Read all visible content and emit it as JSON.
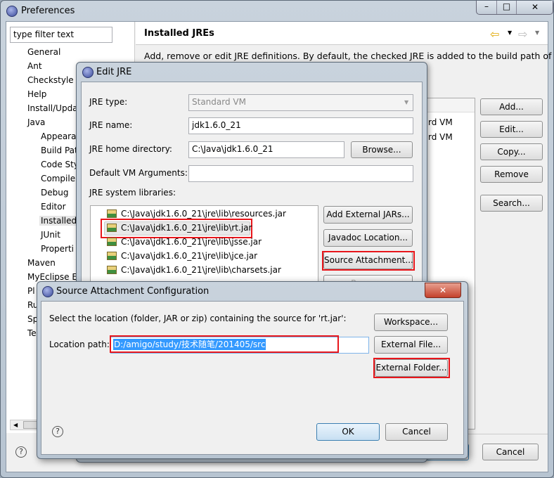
{
  "preferences": {
    "title": "Preferences",
    "filter_placeholder": "type filter text",
    "tree": [
      {
        "label": "General",
        "level": 0
      },
      {
        "label": "Ant",
        "level": 0
      },
      {
        "label": "Checkstyle",
        "level": 0
      },
      {
        "label": "Help",
        "level": 0
      },
      {
        "label": "Install/Upda",
        "level": 0
      },
      {
        "label": "Java",
        "level": 0
      },
      {
        "label": "Appeara",
        "level": 1
      },
      {
        "label": "Build Pat",
        "level": 1
      },
      {
        "label": "Code Sty",
        "level": 1
      },
      {
        "label": "Compiler",
        "level": 1
      },
      {
        "label": "Debug",
        "level": 1
      },
      {
        "label": "Editor",
        "level": 1
      },
      {
        "label": "Installed",
        "level": 1,
        "selected": true
      },
      {
        "label": "JUnit",
        "level": 1
      },
      {
        "label": "Properti",
        "level": 1
      },
      {
        "label": "Maven",
        "level": 0
      },
      {
        "label": "MyEclipse E",
        "level": 0
      },
      {
        "label": "Pl",
        "level": 0
      },
      {
        "label": "Ru",
        "level": 0
      },
      {
        "label": "Sp",
        "level": 0
      },
      {
        "label": "Te",
        "level": 0
      }
    ],
    "page_title": "Installed JREs",
    "description": "Add, remove or edit JRE definitions. By default, the checked JRE is added to the build path of",
    "table_rows": [
      "rd VM",
      "rd VM"
    ],
    "buttons": {
      "add": "Add...",
      "edit": "Edit...",
      "copy": "Copy...",
      "remove": "Remove",
      "search": "Search...",
      "cancel": "Cancel"
    }
  },
  "edit_jre": {
    "title": "Edit JRE",
    "jre_type_label": "JRE type:",
    "jre_type_value": "Standard VM",
    "jre_name_label": "JRE name:",
    "jre_name_value": "jdk1.6.0_21",
    "home_label": "JRE home directory:",
    "home_value": "C:\\Java\\jdk1.6.0_21",
    "browse": "Browse...",
    "vm_args_label": "Default VM Arguments:",
    "vm_args_value": "",
    "libs_label": "JRE system libraries:",
    "libraries": [
      "C:\\Java\\jdk1.6.0_21\\jre\\lib\\resources.jar",
      "C:\\Java\\jdk1.6.0_21\\jre\\lib\\rt.jar",
      "C:\\Java\\jdk1.6.0_21\\jre\\lib\\jsse.jar",
      "C:\\Java\\jdk1.6.0_21\\jre\\lib\\jce.jar",
      "C:\\Java\\jdk1.6.0_21\\jre\\lib\\charsets.jar"
    ],
    "buttons": {
      "add_external": "Add External JARs...",
      "javadoc": "Javadoc Location...",
      "source": "Source Attachment...",
      "remove": "Remove"
    }
  },
  "source_dialog": {
    "title": "Source Attachment Configuration",
    "prompt": "Select the location (folder, JAR or zip) containing the source for 'rt.jar':",
    "location_label": "Location path:",
    "location_value": "D:/amigo/study/技术随笔/201405/src",
    "workspace": "Workspace...",
    "external_file": "External File...",
    "external_folder": "External Folder...",
    "ok": "OK",
    "cancel": "Cancel"
  },
  "colors": {
    "highlight": "#3399ff",
    "annotation": "#e8161b"
  }
}
